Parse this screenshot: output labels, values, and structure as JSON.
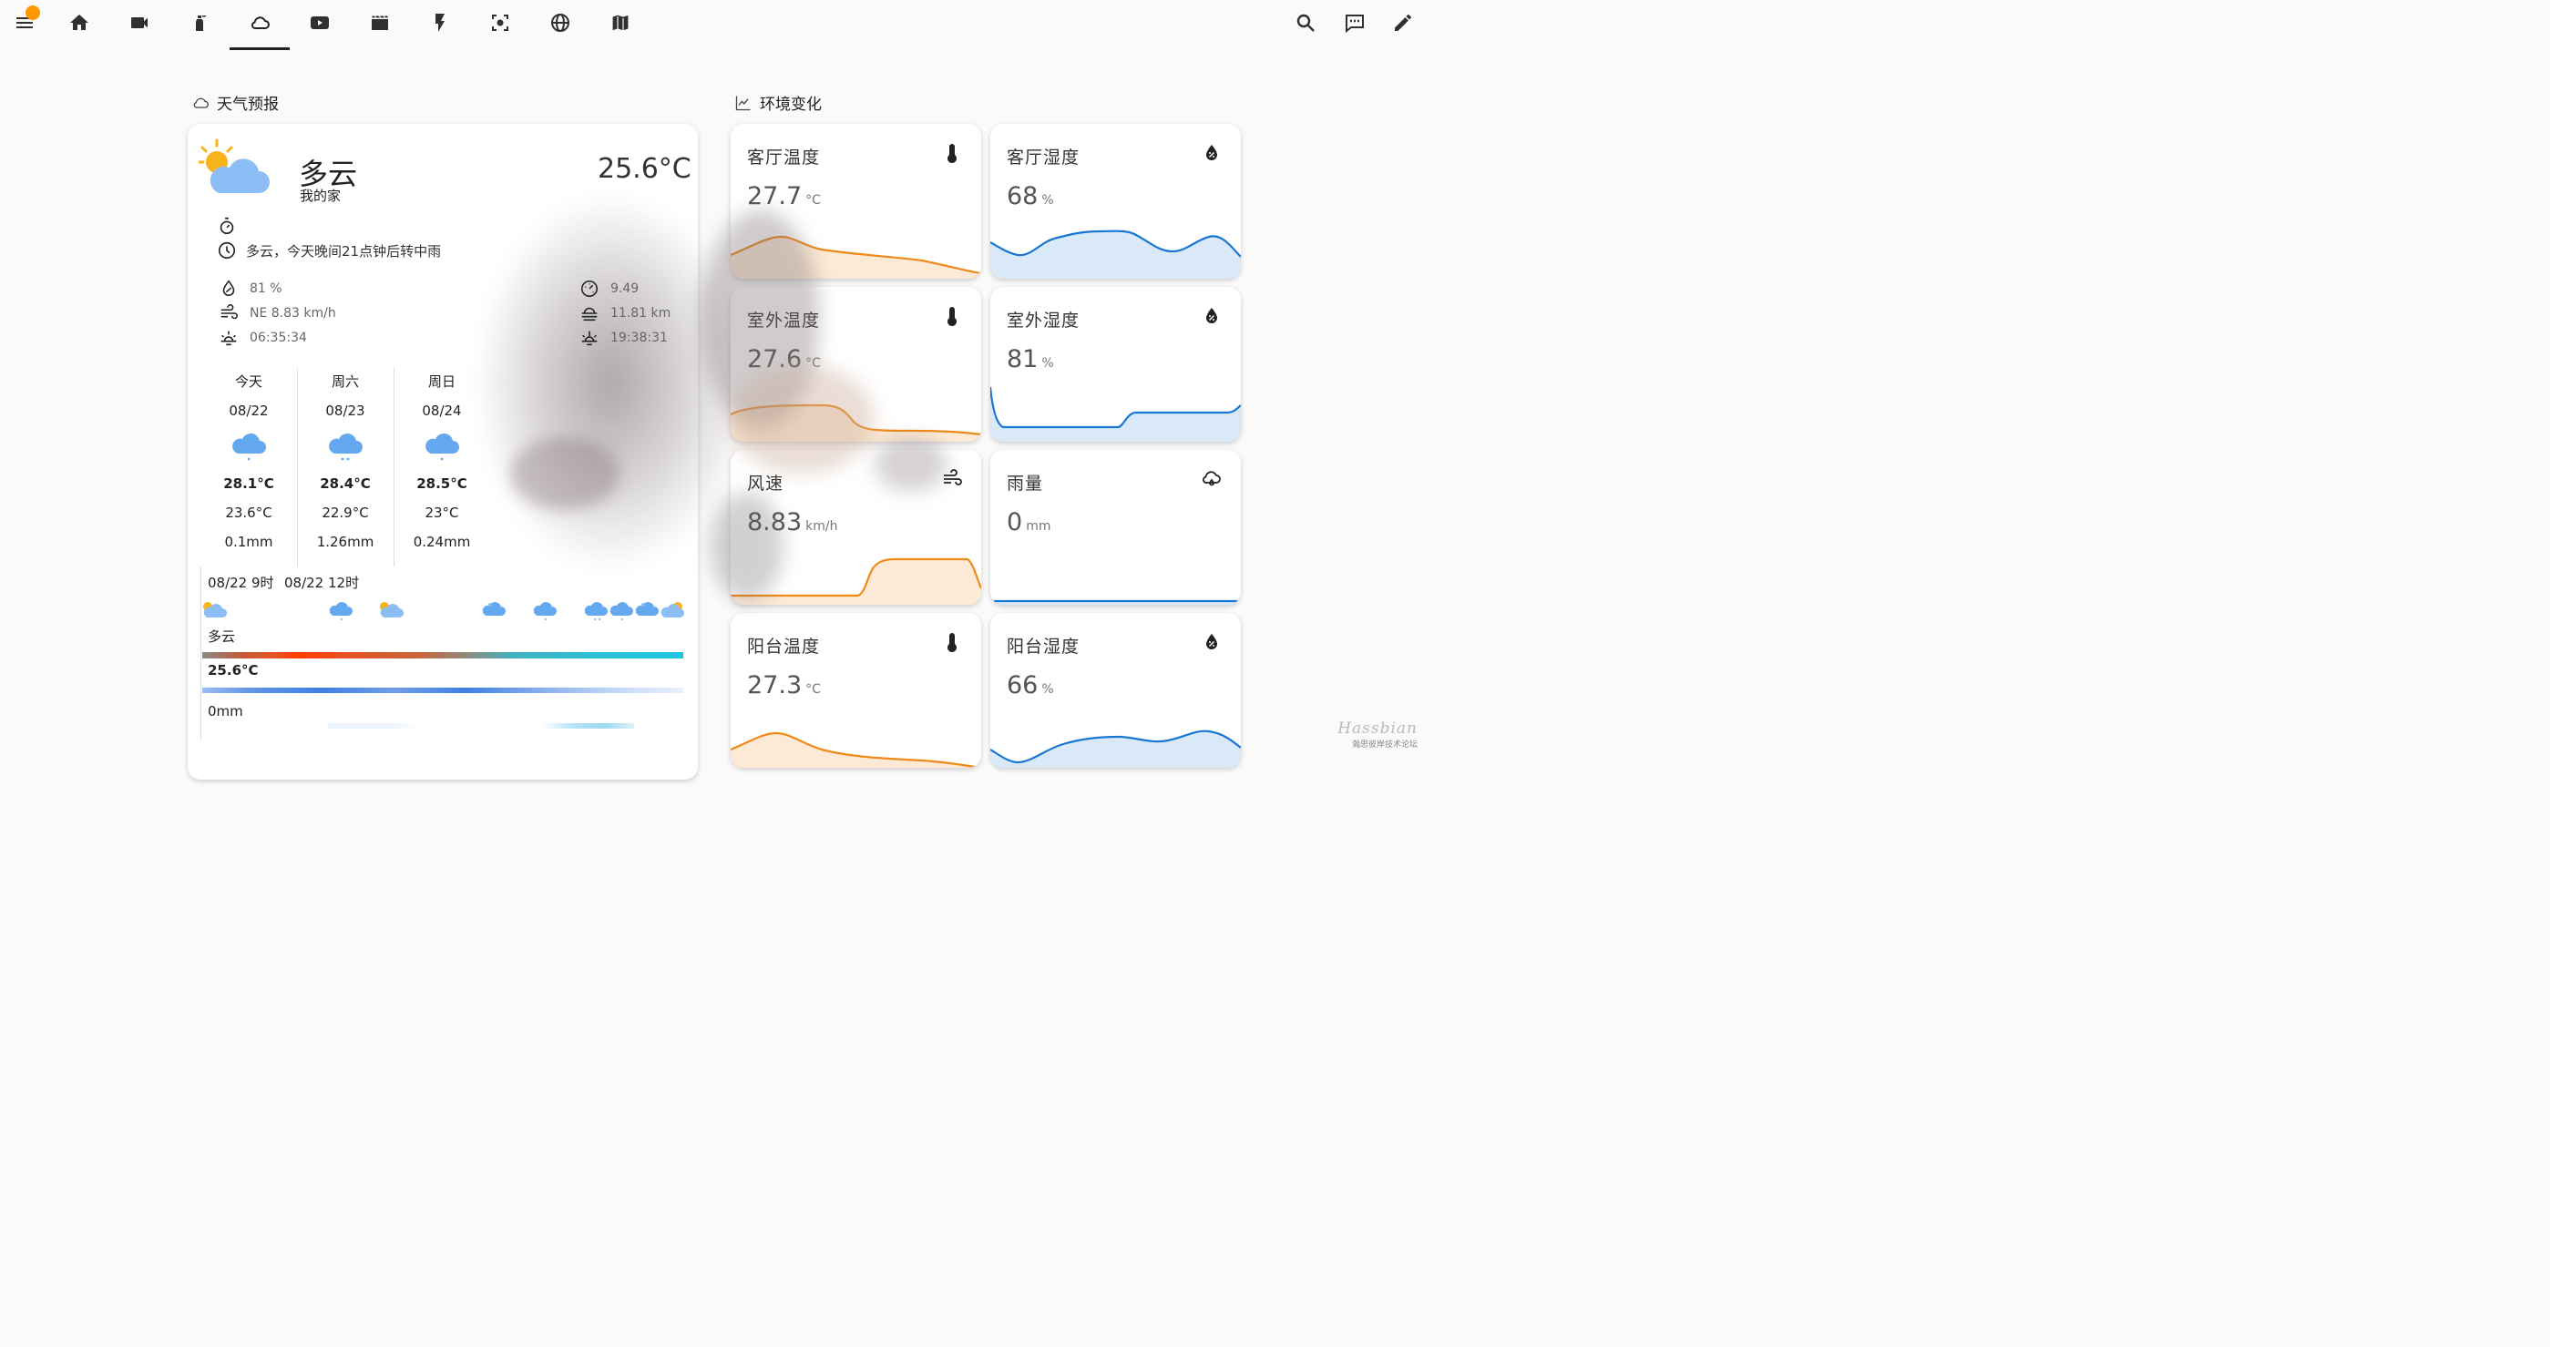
{
  "toolbar": {
    "items": [
      "menu-icon",
      "home-icon",
      "camera-icon",
      "spray-icon",
      "cloud-icon",
      "play-icon",
      "clapper-icon",
      "flash-icon",
      "focus-icon",
      "globe-icon",
      "map-icon"
    ],
    "active": "cloud-icon",
    "right": [
      "search-icon",
      "chat-icon",
      "edit-icon"
    ]
  },
  "sections": {
    "weather": "天气预报",
    "env": "环境变化"
  },
  "weather": {
    "condition": "多云",
    "location": "我的家",
    "temperature": "25.6°C",
    "forecast_text": "多云，今天晚间21点钟后转中雨",
    "humidity": "81 %",
    "wind": "NE 8.83 km/h",
    "sunrise": "06:35:34",
    "pressure": "9.49",
    "visibility": "11.81 km",
    "sunset": "19:38:31",
    "daily": [
      {
        "day": "今天",
        "date": "08/22",
        "hi": "28.1°C",
        "lo": "23.6°C",
        "rain": "0.1mm"
      },
      {
        "day": "周六",
        "date": "08/23",
        "hi": "28.4°C",
        "lo": "22.9°C",
        "rain": "1.26mm"
      },
      {
        "day": "周日",
        "date": "08/24",
        "hi": "28.5°C",
        "lo": "23°C",
        "rain": "0.24mm"
      }
    ],
    "hourly": {
      "time1": "08/22 9时",
      "time2": "08/22 12时",
      "cond": "多云",
      "temp": "25.6°C",
      "rain": "0mm"
    }
  },
  "sensors": [
    {
      "name": "客厅温度",
      "value": "27.7",
      "unit": "°C",
      "icon": "thermometer-icon",
      "color": "#ef8a1a"
    },
    {
      "name": "客厅湿度",
      "value": "68",
      "unit": "%",
      "icon": "water-percent-icon",
      "color": "#1976d2"
    },
    {
      "name": "室外温度",
      "value": "27.6",
      "unit": "°C",
      "icon": "thermometer-icon",
      "color": "#ef8a1a"
    },
    {
      "name": "室外湿度",
      "value": "81",
      "unit": "%",
      "icon": "water-percent-icon",
      "color": "#1976d2"
    },
    {
      "name": "风速",
      "value": "8.83",
      "unit": "km/h",
      "icon": "wind-icon",
      "color": "#ef8a1a"
    },
    {
      "name": "雨量",
      "value": "0",
      "unit": "mm",
      "icon": "rain-cloud-icon",
      "color": "#1976d2"
    },
    {
      "name": "阳台温度",
      "value": "27.3",
      "unit": "°C",
      "icon": "thermometer-icon",
      "color": "#ef8a1a"
    },
    {
      "name": "阳台湿度",
      "value": "66",
      "unit": "%",
      "icon": "water-percent-icon",
      "color": "#1976d2"
    }
  ],
  "watermark": {
    "brand": "Hassbian",
    "sub": "瀚思彼岸技术论坛"
  }
}
